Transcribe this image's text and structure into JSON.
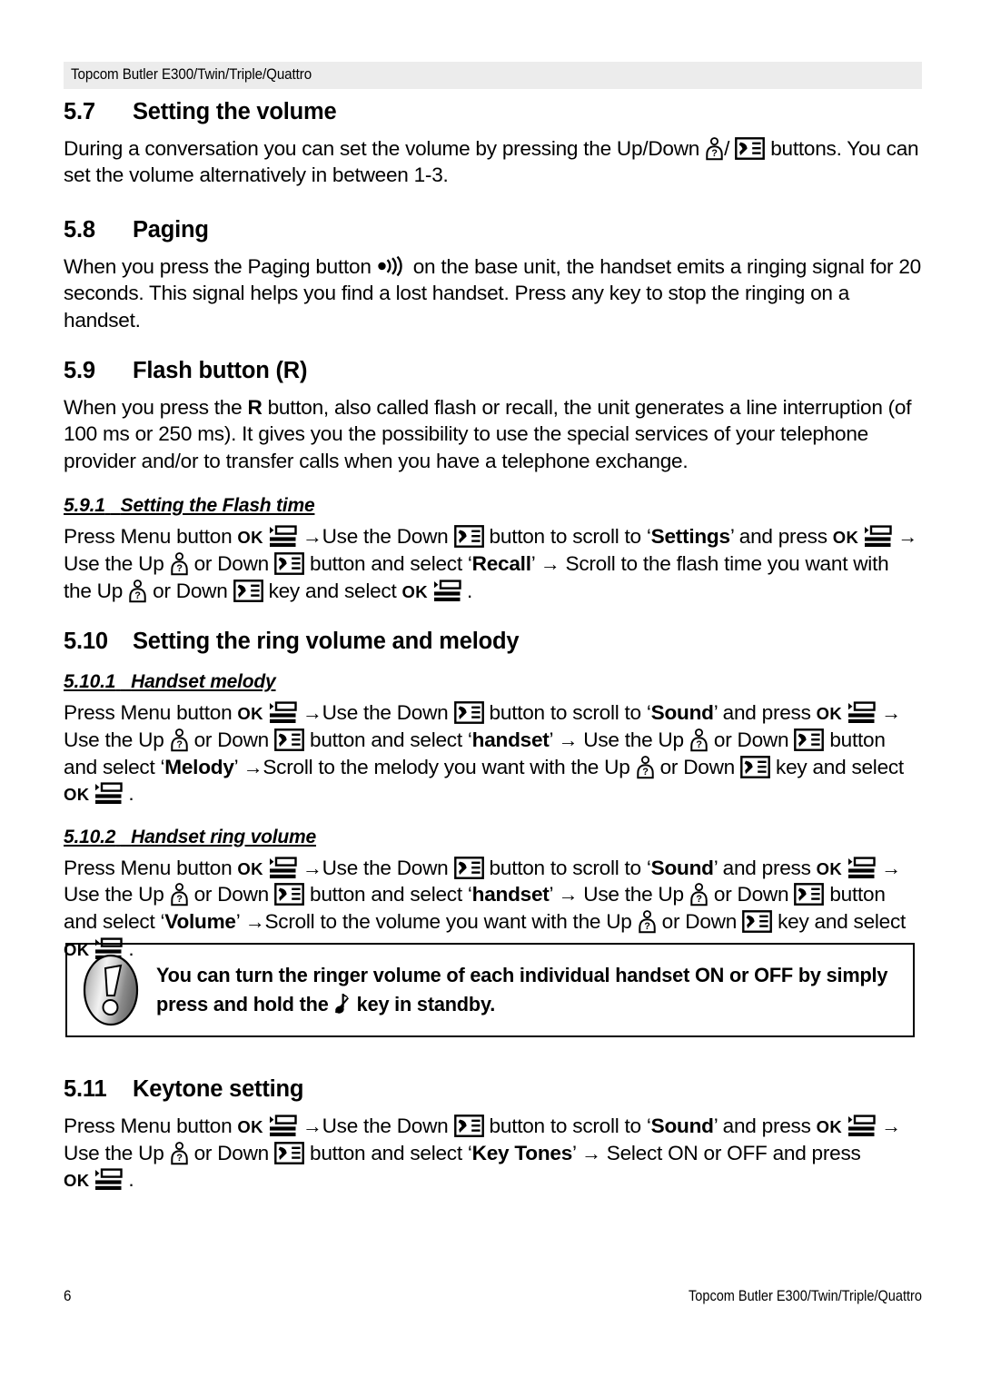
{
  "document": {
    "header_text": "Topcom Butler E300/Twin/Triple/Quattro",
    "footer_page_number": "6",
    "footer_text": "Topcom Butler E300/Twin/Triple/Quattro"
  },
  "icons": {
    "up": "up-person-key-icon",
    "down": "down-phonebook-key-icon",
    "menu": "menu-list-icon",
    "ok": "OK",
    "paging": "paging-signal-icon",
    "note": "music-note-mute-icon",
    "exclamation": "exclamation-notice-icon"
  },
  "sections": [
    {
      "number": "5.7",
      "title": "Setting the volume",
      "paragraphs": [
        {
          "parts": [
            {
              "t": "During a conversation you can set the volume by pressing the Up/Down "
            },
            {
              "icon": "up"
            },
            {
              "t": "/ "
            },
            {
              "icon": "down"
            },
            {
              "t": " buttons. You can set the volume alternatively in between 1-3."
            }
          ]
        }
      ]
    },
    {
      "number": "5.8",
      "title": "Paging",
      "paragraphs": [
        {
          "parts": [
            {
              "t": "When you press the Paging button "
            },
            {
              "icon": "paging"
            },
            {
              "t": "  on the base unit, the handset emits a ringing signal for 20 seconds. This signal helps you find a lost handset. Press any key to stop the ringing on a handset."
            }
          ]
        }
      ]
    },
    {
      "number": "5.9",
      "title": "Flash button (R)",
      "paragraphs": [
        {
          "parts": [
            {
              "t": "When you press the "
            },
            {
              "b": "R"
            },
            {
              "t": " button, also called flash or recall, the unit generates a line interruption (of 100 ms or 250 ms). It gives you the possibility to use the special services of your telephone provider and/or to transfer calls when you have a telephone exchange."
            }
          ]
        }
      ],
      "subsections": [
        {
          "number": "5.9.1",
          "title": "Setting the Flash time",
          "parts": [
            {
              "t": "Press Menu button "
            },
            {
              "icon": "ok"
            },
            {
              "t": " "
            },
            {
              "arrow": "→"
            },
            {
              "t": "Use the Down "
            },
            {
              "icon": "down"
            },
            {
              "t": " button to scroll to ‘"
            },
            {
              "b": "Settings"
            },
            {
              "t": "’ and press "
            },
            {
              "icon": "ok"
            },
            {
              "t": " "
            },
            {
              "arrow": "→"
            },
            {
              "t": " Use the Up "
            },
            {
              "icon": "up"
            },
            {
              "t": " or Down "
            },
            {
              "icon": "down"
            },
            {
              "t": " button and select ‘"
            },
            {
              "b": "Recall"
            },
            {
              "t": "’ "
            },
            {
              "arrow": "→"
            },
            {
              "t": " Scroll to the flash time you want with the Up "
            },
            {
              "icon": "up"
            },
            {
              "t": " or Down "
            },
            {
              "icon": "down"
            },
            {
              "t": " key and select "
            },
            {
              "icon": "ok"
            },
            {
              "t": " ."
            }
          ]
        }
      ]
    },
    {
      "number": "5.10",
      "title": "Setting the ring volume and melody",
      "subsections": [
        {
          "number": "5.10.1",
          "title": "Handset melody",
          "parts": [
            {
              "t": "Press Menu button "
            },
            {
              "icon": "ok"
            },
            {
              "t": " "
            },
            {
              "arrow": "→"
            },
            {
              "t": "Use the Down "
            },
            {
              "icon": "down"
            },
            {
              "t": " button to scroll to ‘"
            },
            {
              "b": "Sound"
            },
            {
              "t": "’ and press "
            },
            {
              "icon": "ok"
            },
            {
              "t": " "
            },
            {
              "arrow": "→"
            },
            {
              "t": " Use the Up "
            },
            {
              "icon": "up"
            },
            {
              "t": " or Down "
            },
            {
              "icon": "down"
            },
            {
              "t": " button and select ‘"
            },
            {
              "b": "handset"
            },
            {
              "t": "’ "
            },
            {
              "arrow": "→"
            },
            {
              "t": " Use the Up "
            },
            {
              "icon": "up"
            },
            {
              "t": " or Down "
            },
            {
              "icon": "down"
            },
            {
              "t": " button and select ‘"
            },
            {
              "b": "Melody"
            },
            {
              "t": "’ "
            },
            {
              "arrow": "→"
            },
            {
              "t": "Scroll to the melody you want with the Up "
            },
            {
              "icon": "up"
            },
            {
              "t": " or Down "
            },
            {
              "icon": "down"
            },
            {
              "t": " key and select "
            },
            {
              "icon": "ok"
            },
            {
              "t": " ."
            }
          ]
        },
        {
          "number": "5.10.2",
          "title": "Handset ring volume",
          "parts": [
            {
              "t": "Press Menu button "
            },
            {
              "icon": "ok"
            },
            {
              "t": " "
            },
            {
              "arrow": "→"
            },
            {
              "t": "Use the Down "
            },
            {
              "icon": "down"
            },
            {
              "t": " button to scroll to ‘"
            },
            {
              "b": "Sound"
            },
            {
              "t": "’ and press "
            },
            {
              "icon": "ok"
            },
            {
              "t": " "
            },
            {
              "arrow": "→"
            },
            {
              "t": " Use the Up "
            },
            {
              "icon": "up"
            },
            {
              "t": " or Down "
            },
            {
              "icon": "down"
            },
            {
              "t": " button and select ‘"
            },
            {
              "b": "handset"
            },
            {
              "t": "’ "
            },
            {
              "arrow": "→"
            },
            {
              "t": " Use the Up "
            },
            {
              "icon": "up"
            },
            {
              "t": " or Down "
            },
            {
              "icon": "down"
            },
            {
              "t": " button and select ‘"
            },
            {
              "b": "Volume"
            },
            {
              "t": "’ "
            },
            {
              "arrow": "→"
            },
            {
              "t": "Scroll to the volume you want with the Up "
            },
            {
              "icon": "up"
            },
            {
              "t": " or Down "
            },
            {
              "icon": "down"
            },
            {
              "t": " key and select "
            },
            {
              "icon": "ok"
            },
            {
              "t": " ."
            }
          ]
        }
      ]
    },
    {
      "number": "5.11",
      "title": "Keytone setting",
      "subsections": [
        {
          "number": "",
          "title": "",
          "parts": [
            {
              "t": "Press Menu button "
            },
            {
              "icon": "ok"
            },
            {
              "t": " "
            },
            {
              "arrow": "→"
            },
            {
              "t": "Use the Down "
            },
            {
              "icon": "down"
            },
            {
              "t": " button to scroll to ‘"
            },
            {
              "b": "Sound"
            },
            {
              "t": "’ and press "
            },
            {
              "icon": "ok"
            },
            {
              "t": " "
            },
            {
              "arrow": "→"
            },
            {
              "t": " Use the Up "
            },
            {
              "icon": "up"
            },
            {
              "t": " or Down "
            },
            {
              "icon": "down"
            },
            {
              "t": " button and select ‘"
            },
            {
              "b": "Key Tones"
            },
            {
              "t": "’ "
            },
            {
              "arrow": "→"
            },
            {
              "t": " Select ON or OFF and press "
            },
            {
              "icon": "ok"
            },
            {
              "t": " ."
            }
          ]
        }
      ]
    }
  ],
  "notice": {
    "parts": [
      {
        "t": "You can turn the ringer volume of each individual handset ON or OFF by simply press and hold the "
      },
      {
        "icon": "note"
      },
      {
        "t": " key in standby."
      }
    ]
  }
}
